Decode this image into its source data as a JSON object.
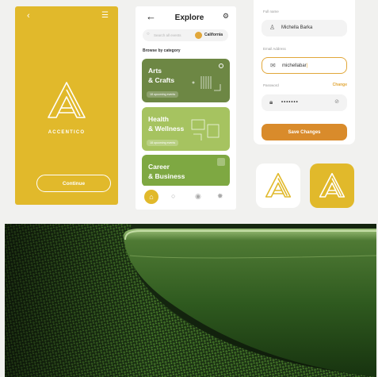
{
  "splash": {
    "back_icon": "chevron-left",
    "menu_icon": "hamburger",
    "brand": "ACCENTICO",
    "continue_label": "Continue"
  },
  "explore": {
    "title": "Explore",
    "search_placeholder": "Search all events",
    "location": "California",
    "browse_label": "Browse by category",
    "categories": [
      {
        "line1": "Arts",
        "line2": "& Crafts",
        "upcoming": "18 upcoming events",
        "color": "#6d8744"
      },
      {
        "line1": "Health",
        "line2": "& Wellness",
        "upcoming": "18 upcoming events",
        "color": "#a6c360"
      },
      {
        "line1": "Career",
        "line2": "& Business",
        "upcoming": "",
        "color": "#7ea842"
      }
    ],
    "nav": [
      "home",
      "search",
      "location",
      "settings"
    ]
  },
  "profile": {
    "full_name_label": "Full name",
    "full_name": "Michella Barka",
    "email_label": "Email Address",
    "email": "michellabar",
    "password_label": "Password",
    "password": "•••••••",
    "change_label": "Change",
    "save_label": "Save Changes"
  },
  "colors": {
    "brand_yellow": "#e1b92b",
    "accent_orange": "#d98b2b",
    "olive": "#6d8744",
    "light_green": "#a6c360"
  }
}
